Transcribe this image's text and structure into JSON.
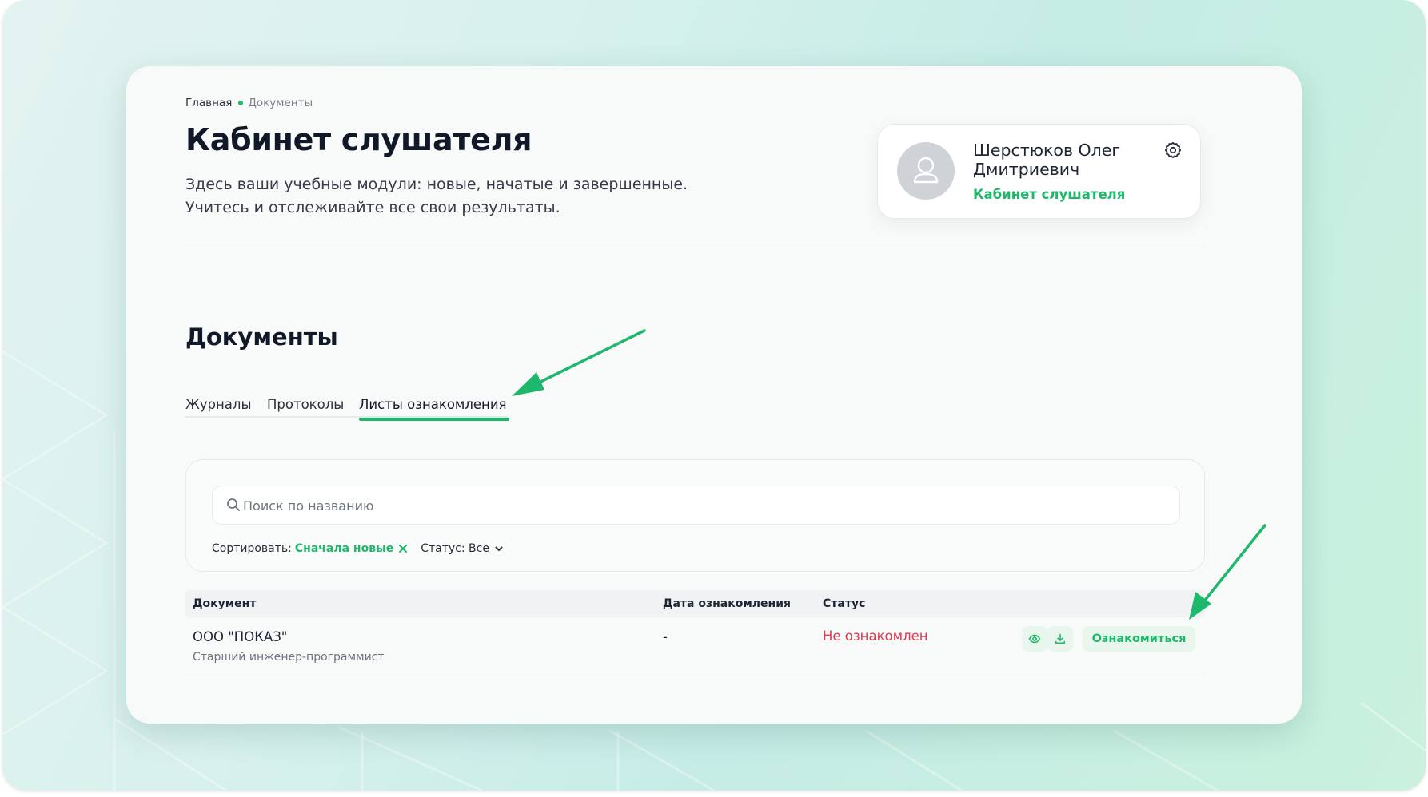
{
  "breadcrumb": {
    "home": "Главная",
    "current": "Документы"
  },
  "page": {
    "title": "Кабинет слушателя",
    "description_line1": "Здесь ваши учебные модули: новые, начатые и завершенные.",
    "description_line2": "Учитесь и отслеживайте все свои результаты."
  },
  "profile": {
    "name": "Шерстюков Олег Дмитриевич",
    "role": "Кабинет слушателя",
    "avatar_icon": "user-icon",
    "settings_icon": "gear-icon"
  },
  "documents": {
    "title": "Документы",
    "tabs": [
      {
        "label": "Журналы",
        "active": false
      },
      {
        "label": "Протоколы",
        "active": false
      },
      {
        "label": "Листы ознакомления",
        "active": true
      }
    ],
    "search": {
      "placeholder": "Поиск по названию",
      "value": ""
    },
    "sort": {
      "label": "Сортировать:",
      "value": "Сначала новые"
    },
    "status_filter": {
      "label": "Статус: Все"
    },
    "table": {
      "columns": [
        "Документ",
        "Дата ознакомления",
        "Статус"
      ],
      "rows": [
        {
          "title": "ООО \"ПОКАЗ\"",
          "subtitle": "Старший инженер-программист",
          "date": "-",
          "status": "Не ознакомлен",
          "action": "Ознакомиться"
        }
      ]
    }
  },
  "colors": {
    "accent": "#1fb86a",
    "status_negative": "#e0384f",
    "annotation_arrow": "#1db86c"
  }
}
